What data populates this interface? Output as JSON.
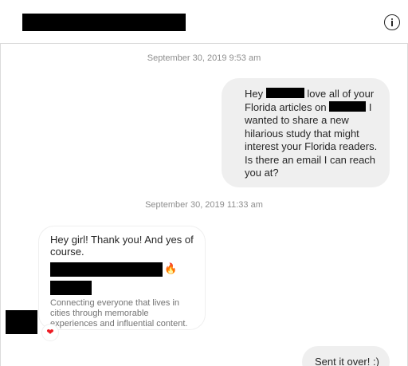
{
  "header": {
    "info_icon": "info-circle-icon"
  },
  "timestamps": {
    "first": "September 30, 2019 9:53 am",
    "second": "September 30, 2019 11:33 am"
  },
  "message_out": {
    "part1": "Hey",
    "part2": "love all of your Florida articles on",
    "part3": "I wanted to share a new hilarious study that might interest your Florida readers. Is there an email I can reach you at?"
  },
  "message_in": {
    "greeting": "Hey girl! Thank you! And yes of course.",
    "emoji": "fire-icon",
    "bio": "Connecting everyone that lives in cities through memorable experiences and influential content.",
    "reaction_icon": "heart-icon"
  },
  "message_partial": {
    "text": "Sent it over! :)"
  }
}
